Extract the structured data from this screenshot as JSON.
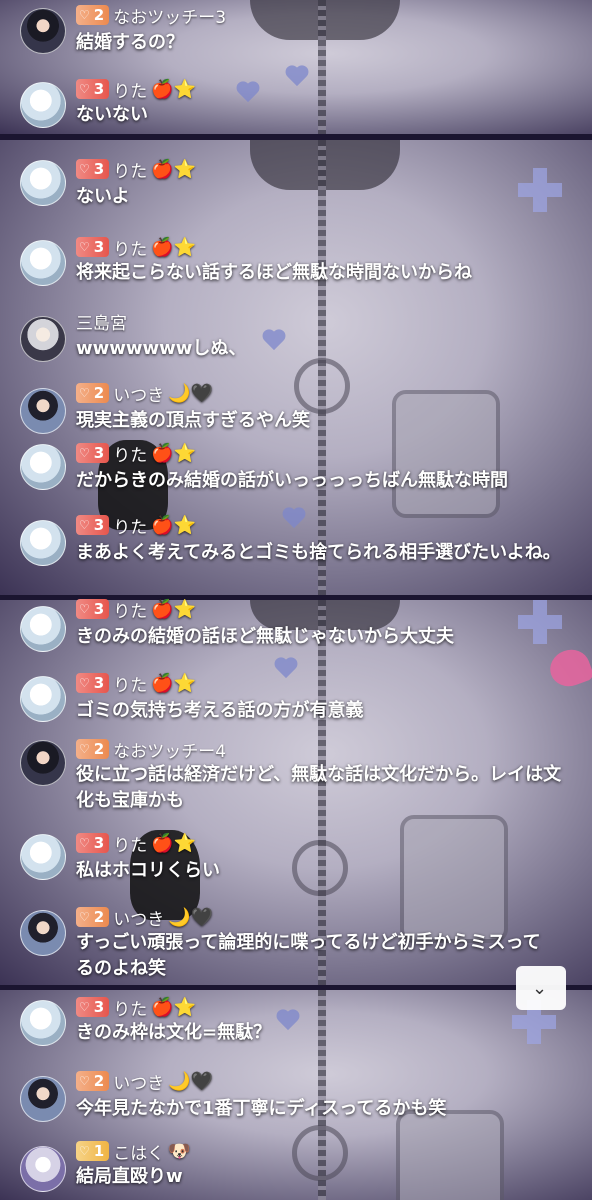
{
  "messages": [
    {
      "level": "2",
      "name": "なおツッチー3",
      "emoji": "",
      "text": "結婚するの？"
    },
    {
      "level": "3",
      "name": "りた",
      "emoji": "🍎⭐",
      "text": "ないない"
    },
    {
      "level": "3",
      "name": "りた",
      "emoji": "🍎⭐",
      "text": "ないよ"
    },
    {
      "level": "3",
      "name": "りた",
      "emoji": "🍎⭐",
      "text": "将来起こらない話するほど無駄な時間ないからね"
    },
    {
      "level": "",
      "name": "三島宮",
      "emoji": "",
      "text": "wwwwwwwしぬ、"
    },
    {
      "level": "2",
      "name": "いつき",
      "emoji": "🌙🖤",
      "text": "現実主義の頂点すぎるやん笑"
    },
    {
      "level": "3",
      "name": "りた",
      "emoji": "🍎⭐",
      "text": "だからきのみ結婚の話がいっっっっちばん無駄な時間"
    },
    {
      "level": "3",
      "name": "りた",
      "emoji": "🍎⭐",
      "text": "まあよく考えてみるとゴミも捨てられる相手選びたいよね。"
    },
    {
      "level": "3",
      "name": "りた",
      "emoji": "🍎⭐",
      "text": "きのみの結婚の話ほど無駄じゃないから大丈夫"
    },
    {
      "level": "3",
      "name": "りた",
      "emoji": "🍎⭐",
      "text": "ゴミの気持ち考える話の方が有意義"
    },
    {
      "level": "2",
      "name": "なおツッチー4",
      "emoji": "",
      "text": "役に立つ話は経済だけど、無駄な話は文化だから。レイは文化も宝庫かも"
    },
    {
      "level": "3",
      "name": "りた",
      "emoji": "🍎⭐",
      "text": "私はホコリくらい"
    },
    {
      "level": "2",
      "name": "いつき",
      "emoji": "🌙🖤",
      "text": "すっごい頑張って論理的に喋ってるけど初手からミスってるのよね笑"
    },
    {
      "level": "3",
      "name": "りた",
      "emoji": "🍎⭐",
      "text": "きのみ枠は文化=無駄？"
    },
    {
      "level": "2",
      "name": "いつき",
      "emoji": "🌙🖤",
      "text": "今年見たなかで1番丁寧にディスってるかも笑"
    },
    {
      "level": "1",
      "name": "こはく",
      "emoji": "🐶",
      "text": "結局直殴りw"
    }
  ],
  "scroll_button": {
    "icon": "chevron-down-icon",
    "glyph": "⌄"
  }
}
